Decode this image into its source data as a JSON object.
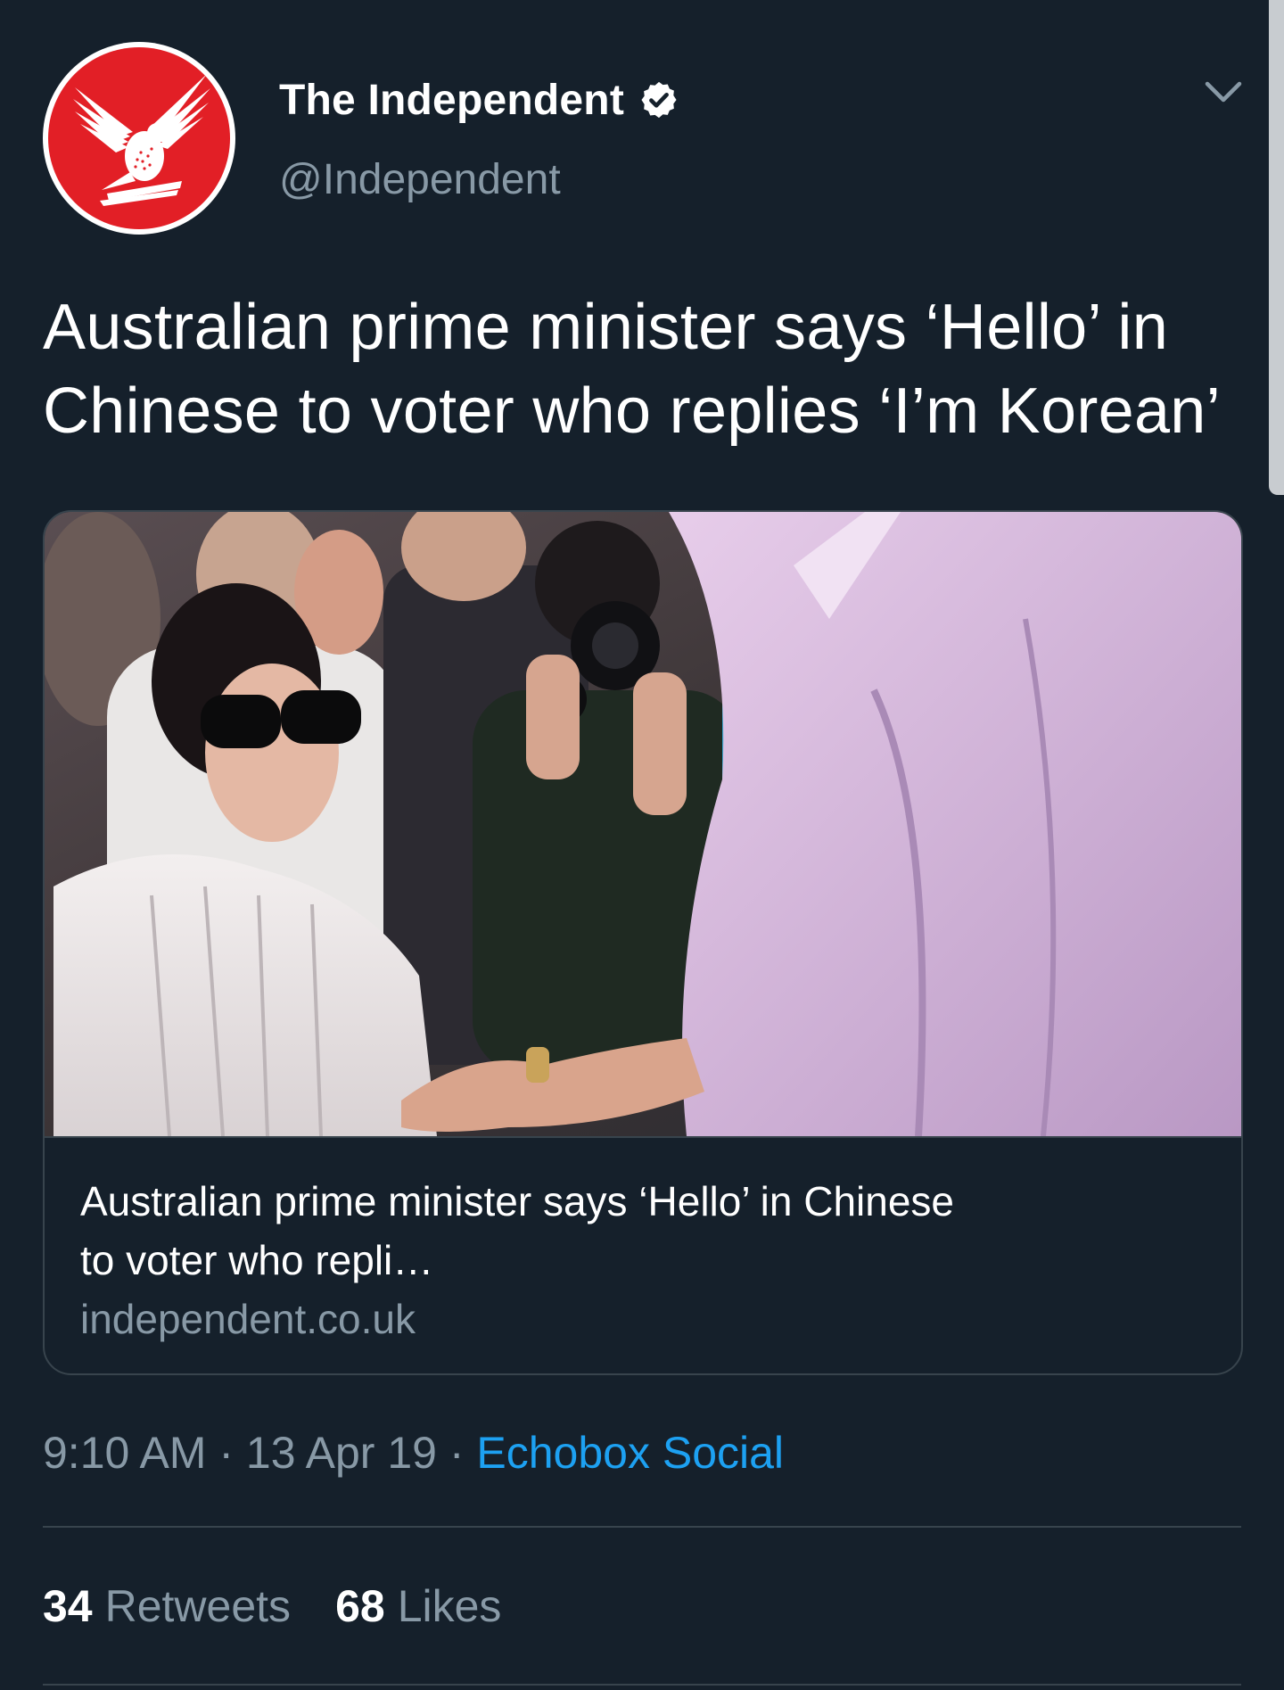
{
  "tweet": {
    "author": {
      "display_name": "The Independent",
      "handle": "@Independent",
      "verified": true,
      "avatar_icon": "eagle-logo-icon",
      "avatar_color": "#e21f26"
    },
    "text_line1": "Australian prime minister says ‘Hello’ in",
    "text_line2": "Chinese to voter who replies ‘I’m Korean’",
    "card": {
      "title_line1": "Australian prime minister says ‘Hello’ in Chinese",
      "title_line2": "to voter who repli…",
      "domain": "independent.co.uk"
    },
    "meta": {
      "time": "9:10 AM",
      "separator": " · ",
      "date": "13 Apr 19",
      "source": "Echobox Social"
    },
    "stats": {
      "retweets_count": "34",
      "retweets_label": "Retweets",
      "likes_count": "68",
      "likes_label": "Likes"
    }
  },
  "colors": {
    "background": "#15202b",
    "secondary_text": "#8899a6",
    "link": "#1da1f2",
    "border": "#38444d"
  }
}
